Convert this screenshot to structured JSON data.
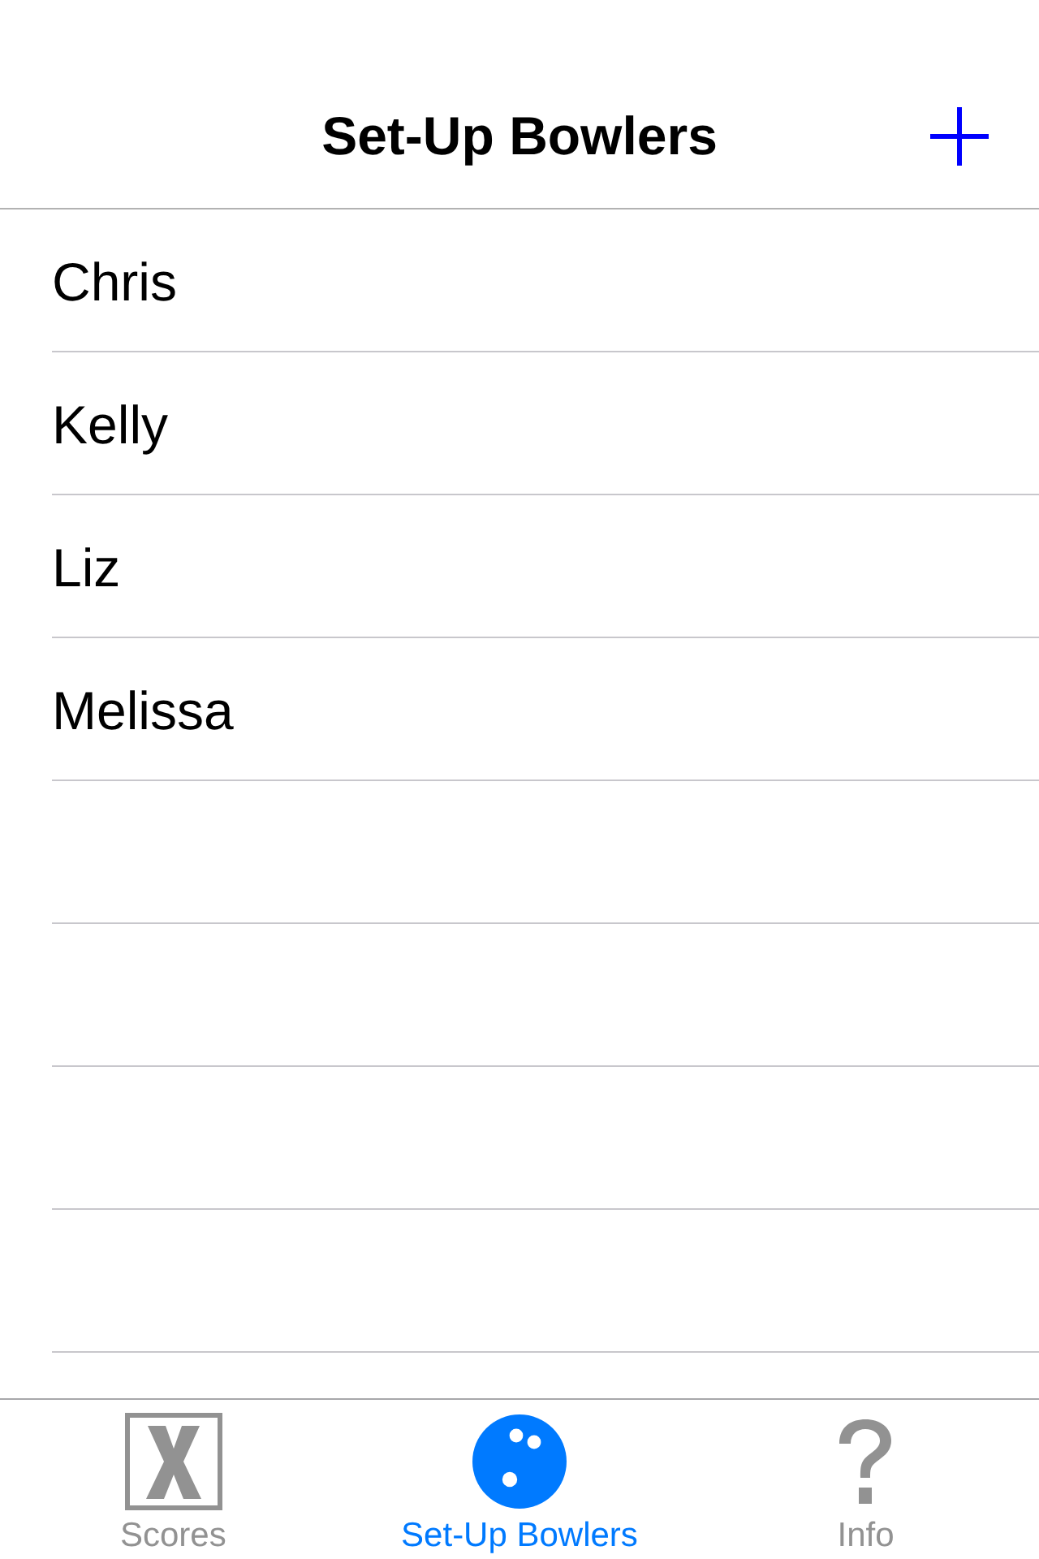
{
  "navigation_bar": {
    "title": "Set-Up Bowlers"
  },
  "bowlers": [
    {
      "name": "Chris"
    },
    {
      "name": "Kelly"
    },
    {
      "name": "Liz"
    },
    {
      "name": "Melissa"
    }
  ],
  "tab_bar": {
    "tabs": [
      {
        "label": "Scores",
        "selected": false
      },
      {
        "label": "Set-Up Bowlers",
        "selected": true
      },
      {
        "label": "Info",
        "selected": false
      }
    ]
  }
}
